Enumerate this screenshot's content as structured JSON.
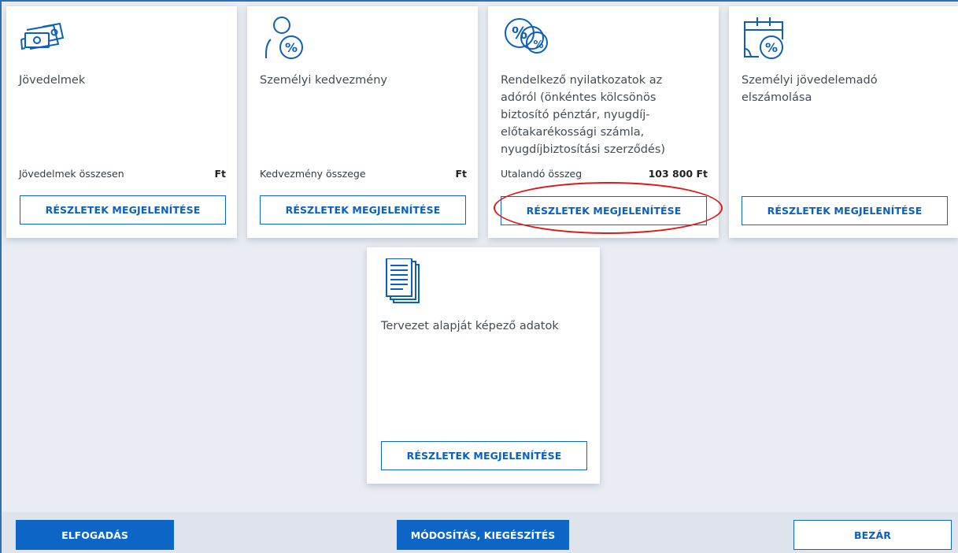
{
  "cards": [
    {
      "title": "Jövedelmek",
      "icon": "money-icon",
      "amount_label": "Jövedelmek összesen",
      "amount_value": "Ft",
      "button": "RÉSZLETEK MEGJELENÍTÉSE"
    },
    {
      "title": "Személyi kedvezmény",
      "icon": "person-percent-icon",
      "amount_label": "Kedvezmény összege",
      "amount_value": "Ft",
      "button": "RÉSZLETEK MEGJELENÍTÉSE"
    },
    {
      "title": "Rendelkező nyilatkozatok az adóról (önkéntes kölcsönös biztosító pénztár, nyugdíj-előtakarékossági számla, nyugdíjbiztosítási szerződés)",
      "title_lines": [
        "Rendelkező nyilatkozatok az",
        "adóról (önkéntes kölcsönös",
        "biztosító pénztár, nyugdíj-",
        "előtakarékossági számla,",
        "nyugdíjbiztosítási szerződés)"
      ],
      "icon": "percent-coins-icon",
      "amount_label": "Utalandó összeg",
      "amount_value": "103 800 Ft",
      "button": "RÉSZLETEK MEGJELENÍTÉSE"
    },
    {
      "title": "Személyi jövedelemadó elszámolása",
      "title_lines": [
        "Személyi jövedelemadó",
        "elszámolása"
      ],
      "icon": "calendar-percent-icon",
      "button": "RÉSZLETEK MEGJELENÍTÉSE"
    },
    {
      "title": "Tervezet alapját képező adatok",
      "icon": "documents-icon",
      "button": "RÉSZLETEK MEGJELENÍTÉSE"
    }
  ],
  "footer": {
    "accept": "ELFOGADÁS",
    "modify": "MÓDOSÍTÁS, KIEGÉSZÍTÉS",
    "close": "BEZÁR"
  },
  "colors": {
    "accent": "#0d66c6",
    "background": "#e9edf3",
    "highlight": "#e01818"
  }
}
